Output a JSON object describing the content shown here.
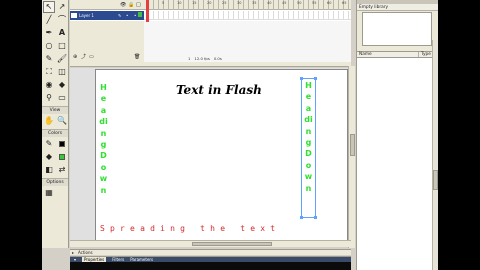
{
  "timeline": {
    "layer_name": "Layer 1",
    "ruler_numbers": [
      "5",
      "10",
      "15",
      "20",
      "25",
      "30",
      "35",
      "40",
      "45",
      "50",
      "55",
      "60",
      "65",
      "70"
    ],
    "status_frame": "1",
    "status_fps": "12.0 fps",
    "status_time": "0.0s"
  },
  "tools": {
    "section_view": "View",
    "section_colors": "Colors",
    "section_options": "Options"
  },
  "stage": {
    "title_text": "Text in Flash",
    "vertical_left": "Heading Down",
    "vertical_right": "Heading Down",
    "spread_text": "Spreading the text",
    "colors": {
      "green": "#2fe02f",
      "red": "#d42b2b",
      "selection": "#5fa3ff"
    }
  },
  "panels": {
    "actions_label": "Actions",
    "properties_tabs": [
      "Properties",
      "Filters",
      "Parameters"
    ]
  },
  "library": {
    "title": "Empty library",
    "col_name": "Name",
    "col_type": "Type"
  }
}
